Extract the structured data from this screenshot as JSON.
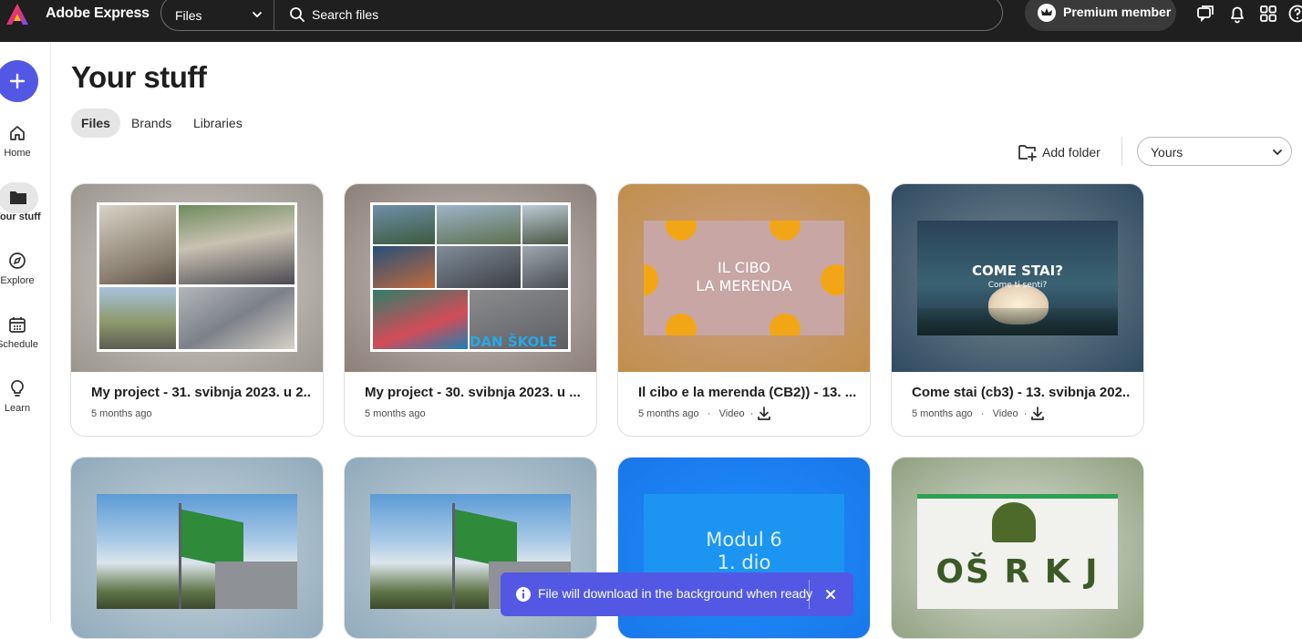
{
  "topbar": {
    "app_name": "Adobe Express",
    "search_scope": "Files",
    "search_placeholder": "Search files",
    "premium_label": "Premium member"
  },
  "rail": {
    "items": [
      {
        "label": "Home"
      },
      {
        "label": "Your stuff"
      },
      {
        "label": "Explore"
      },
      {
        "label": "Schedule"
      },
      {
        "label": "Learn"
      }
    ]
  },
  "main": {
    "title": "Your stuff",
    "tabs": [
      {
        "label": "Files",
        "active": true
      },
      {
        "label": "Brands"
      },
      {
        "label": "Libraries"
      }
    ],
    "add_folder_label": "Add folder",
    "owner_filter": "Yours"
  },
  "cards": [
    {
      "title": "My project - 31. svibnja 2023. u 2...",
      "meta": "5 months ago",
      "type": ""
    },
    {
      "title": "My project - 30. svibnja 2023. u ...",
      "meta": "5 months ago",
      "type": "",
      "overlay_text": "DAN ŠKOLE"
    },
    {
      "title": "Il cibo e la merenda (CB2)) - 13. ...",
      "meta": "5 months ago",
      "type": "Video",
      "overlay_text": "IL CIBO\nLA MERENDA"
    },
    {
      "title": "Come stai (cb3) - 13. svibnja 202...",
      "meta": "5 months ago",
      "type": "Video",
      "overlay_text": "COME STAI?",
      "overlay_sub": "Come ti senti?"
    },
    {
      "title": "",
      "meta": ""
    },
    {
      "title": "",
      "meta": ""
    },
    {
      "title": "",
      "meta": "",
      "overlay_text": "Modul 6\n1. dio"
    },
    {
      "title": "",
      "meta": "",
      "overlay_text": "OŠ R K J"
    }
  ],
  "toast": {
    "message": "File will download in the background when ready"
  },
  "colors": {
    "topbar": "#1f1f1f",
    "accent": "#5258e4"
  }
}
